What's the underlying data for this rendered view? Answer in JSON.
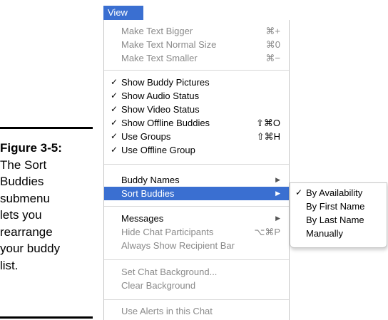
{
  "caption": {
    "figure": "Figure 3-5:",
    "lines": [
      "The Sort",
      "Buddies",
      "submenu",
      "lets you",
      "rearrange",
      "your buddy",
      "list."
    ]
  },
  "menu_title": "View",
  "menu": {
    "make_bigger": {
      "label": "Make Text Bigger",
      "shortcut": "⌘+"
    },
    "make_normal": {
      "label": "Make Text Normal Size",
      "shortcut": "⌘0"
    },
    "make_smaller": {
      "label": "Make Text Smaller",
      "shortcut": "⌘−"
    },
    "show_pictures": {
      "label": "Show Buddy Pictures",
      "check": "✓"
    },
    "show_audio": {
      "label": "Show Audio Status",
      "check": "✓"
    },
    "show_video": {
      "label": "Show Video Status",
      "check": "✓"
    },
    "show_offline": {
      "label": "Show Offline Buddies",
      "check": "✓",
      "shortcut": "⇧⌘O"
    },
    "use_groups": {
      "label": "Use Groups",
      "check": "✓",
      "shortcut": "⇧⌘H"
    },
    "use_offline_group": {
      "label": "Use Offline Group",
      "check": "✓"
    },
    "buddy_names": {
      "label": "Buddy Names",
      "arrow": "▶"
    },
    "sort_buddies": {
      "label": "Sort Buddies",
      "arrow": "▶"
    },
    "messages": {
      "label": "Messages",
      "arrow": "▶"
    },
    "hide_participants": {
      "label": "Hide Chat Participants",
      "shortcut": "⌥⌘P"
    },
    "always_show_recipient": {
      "label": "Always Show Recipient Bar"
    },
    "set_background": {
      "label": "Set Chat Background..."
    },
    "clear_background": {
      "label": "Clear Background"
    },
    "use_alerts": {
      "label": "Use Alerts in this Chat"
    }
  },
  "submenu": {
    "by_availability": {
      "label": "By Availability",
      "check": "✓"
    },
    "by_first_name": {
      "label": "By First Name"
    },
    "by_last_name": {
      "label": "By Last Name"
    },
    "manually": {
      "label": "Manually"
    }
  }
}
